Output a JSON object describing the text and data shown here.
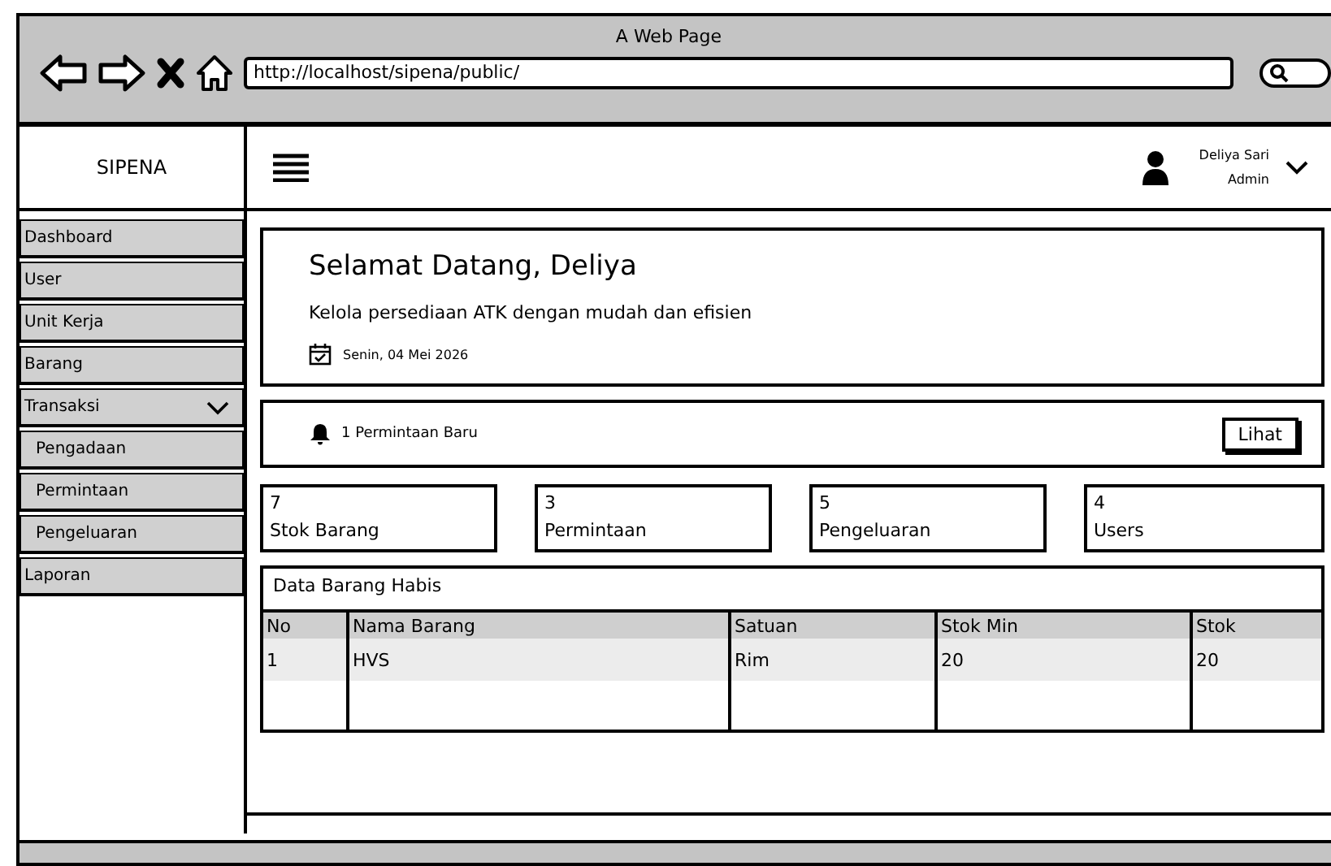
{
  "browser": {
    "title": "A Web Page",
    "url": "http://localhost/sipena/public/"
  },
  "brand": "SIPENA",
  "user": {
    "name": "Deliya Sari",
    "role": "Admin"
  },
  "sidebar": {
    "items": [
      {
        "label": "Dashboard"
      },
      {
        "label": "User"
      },
      {
        "label": "Unit Kerja"
      },
      {
        "label": "Barang"
      },
      {
        "label": "Transaksi",
        "expanded": true,
        "children": [
          {
            "label": "Pengadaan"
          },
          {
            "label": "Permintaan"
          },
          {
            "label": "Pengeluaran"
          }
        ]
      },
      {
        "label": "Laporan"
      }
    ]
  },
  "welcome": {
    "title": "Selamat Datang, Deliya",
    "subtitle": "Kelola persediaan ATK dengan mudah dan efisien",
    "date": "Senin, 04 Mei 2026"
  },
  "notification": {
    "text": "1 Permintaan Baru",
    "button": "Lihat"
  },
  "stats": [
    {
      "value": "7",
      "label": "Stok Barang"
    },
    {
      "value": "3",
      "label": "Permintaan"
    },
    {
      "value": "5",
      "label": "Pengeluaran"
    },
    {
      "value": "4",
      "label": "Users"
    }
  ],
  "table": {
    "title": "Data Barang Habis",
    "columns": [
      "No",
      "Nama Barang",
      "Satuan",
      "Stok Min",
      "Stok"
    ],
    "rows": [
      [
        "1",
        "HVS",
        "Rim",
        "20",
        "20"
      ]
    ]
  }
}
